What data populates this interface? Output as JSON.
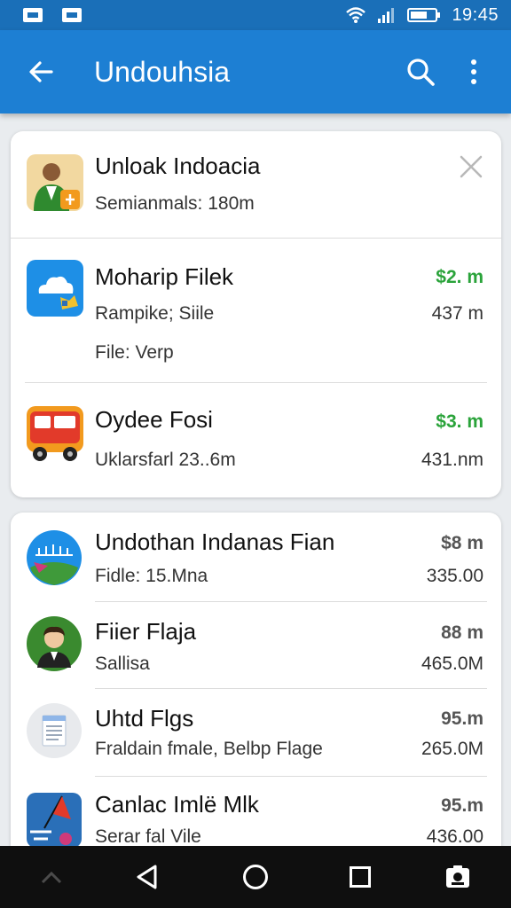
{
  "status_bar": {
    "time": "19:45"
  },
  "app_bar": {
    "title": "Undouhsia"
  },
  "card1": {
    "header_item": {
      "title": "Unloak Indoacia",
      "subtitle": "Semianmals: 180m"
    },
    "items": [
      {
        "title": "Moharip Filek",
        "line1": "Rampike; Siile",
        "line2": "File: Verp",
        "price": "$2. m",
        "size": "437 m"
      },
      {
        "title": "Oydee Fosi",
        "line1": "Uklarsfarl 23..6m",
        "price": "$3. m",
        "size": "431.nm"
      }
    ]
  },
  "card2": {
    "items": [
      {
        "title": "Undothan  Indanas Fian",
        "subtitle": "Fidle: 15.Mna",
        "price": "$8 m",
        "size": "335.00"
      },
      {
        "title": "Fiier Flaja",
        "subtitle": "Sallisa",
        "price": "88 m",
        "size": "465.0M"
      },
      {
        "title": "Uhtd Flgs",
        "subtitle": "Fraldain fmale, Belbp Flage",
        "price": "95.m",
        "size": "265.0M"
      },
      {
        "title": "Canlac Imlë Mlk",
        "subtitle": "Serar fal Vile",
        "price": "95.m",
        "size": "436.00"
      }
    ]
  },
  "colors": {
    "app_bar": "#1d7fd3",
    "status_bar": "#1a6fb8",
    "accent_green": "#2aa33a",
    "nav_bar": "#0f0f0f"
  },
  "icons": [
    "back-arrow-icon",
    "search-icon",
    "more-vert-icon",
    "close-icon",
    "wifi-icon",
    "signal-icon",
    "battery-icon",
    "nav-back-icon",
    "nav-home-icon",
    "nav-recents-icon",
    "nav-screenshot-icon"
  ]
}
